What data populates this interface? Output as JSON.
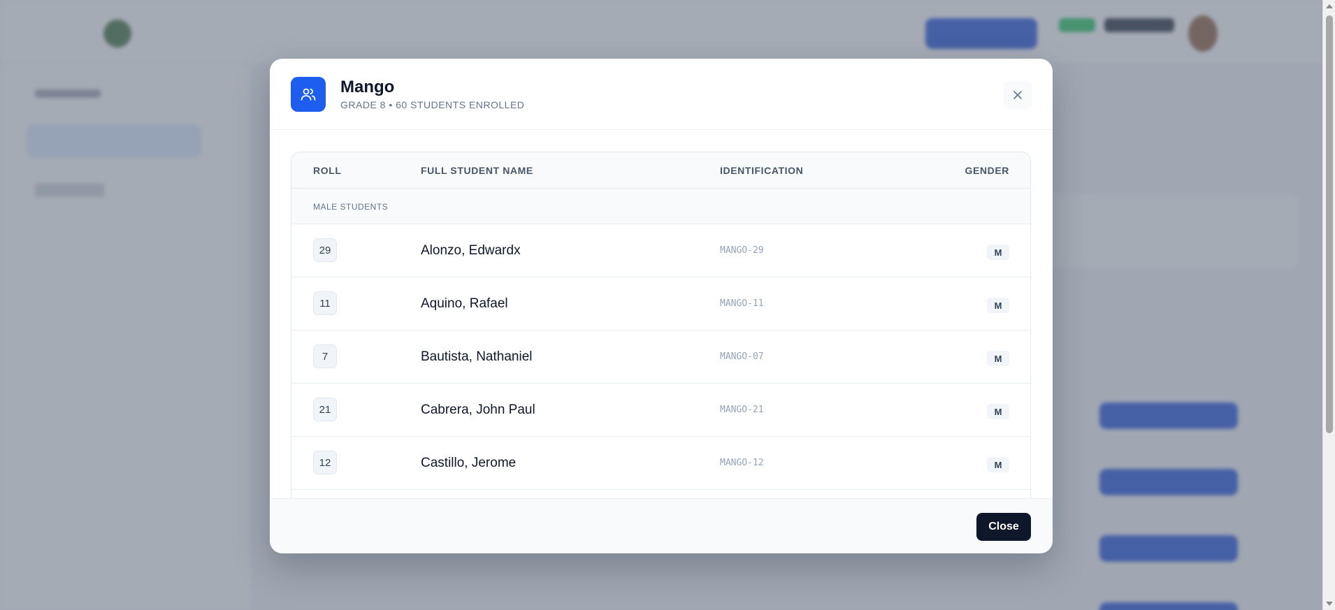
{
  "modal": {
    "title": "Mango",
    "subtitle": "GRADE 8 • 60 STUDENTS ENROLLED",
    "icon": "users-icon",
    "accent_color": "#1d5df0"
  },
  "table": {
    "headers": {
      "roll": "ROLL",
      "name": "FULL STUDENT NAME",
      "identification": "IDENTIFICATION",
      "gender": "GENDER"
    },
    "group_label": "MALE STUDENTS",
    "rows": [
      {
        "roll": "29",
        "name": "Alonzo, Edwardx",
        "id": "MANGO-29",
        "gender": "M"
      },
      {
        "roll": "11",
        "name": "Aquino, Rafael",
        "id": "MANGO-11",
        "gender": "M"
      },
      {
        "roll": "7",
        "name": "Bautista, Nathaniel",
        "id": "MANGO-07",
        "gender": "M"
      },
      {
        "roll": "21",
        "name": "Cabrera, John Paul",
        "id": "MANGO-21",
        "gender": "M"
      },
      {
        "roll": "12",
        "name": "Castillo, Jerome",
        "id": "MANGO-12",
        "gender": "M"
      },
      {
        "roll": "",
        "name": "",
        "id": "",
        "gender": ""
      }
    ]
  },
  "footer": {
    "close_label": "Close",
    "button_color": "#0f172a"
  }
}
